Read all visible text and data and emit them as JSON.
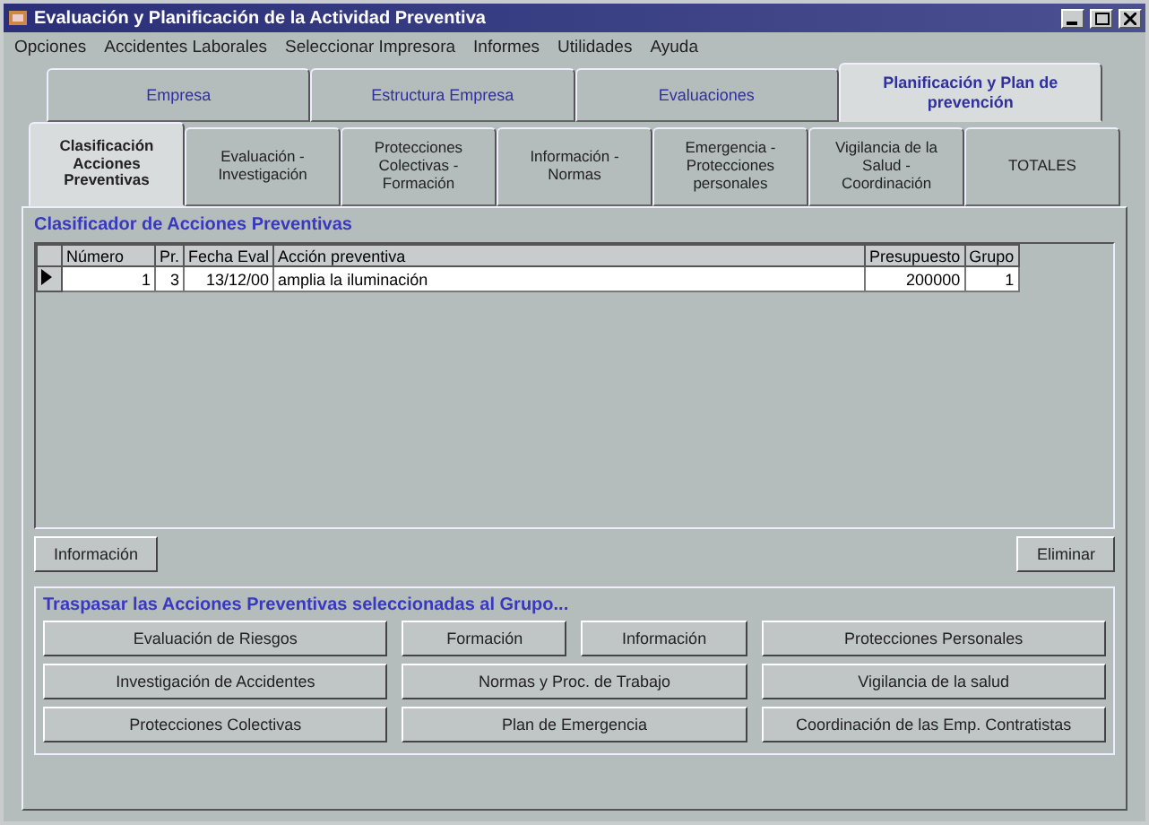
{
  "window": {
    "title": "Evaluación y Planificación de la Actividad Preventiva"
  },
  "menu": [
    "Opciones",
    "Accidentes Laborales",
    "Seleccionar Impresora",
    "Informes",
    "Utilidades",
    "Ayuda"
  ],
  "tabs": [
    {
      "label": "Empresa",
      "selected": false
    },
    {
      "label": "Estructura Empresa",
      "selected": false
    },
    {
      "label": "Evaluaciones",
      "selected": false
    },
    {
      "label": "Planificación y Plan de prevención",
      "selected": true
    }
  ],
  "subtabs": [
    {
      "label": "Clasificación Acciones Preventivas",
      "selected": true
    },
    {
      "label": "Evaluación - Investigación",
      "selected": false
    },
    {
      "label": "Protecciones Colectivas - Formación",
      "selected": false
    },
    {
      "label": "Información - Normas",
      "selected": false
    },
    {
      "label": "Emergencia - Protecciones personales",
      "selected": false
    },
    {
      "label": "Vigilancia de la Salud - Coordinación",
      "selected": false
    },
    {
      "label": "TOTALES",
      "selected": false
    }
  ],
  "panel": {
    "title": "Clasificador de Acciones Preventivas"
  },
  "table": {
    "columns": [
      "Número",
      "Pr.",
      "Fecha Eval",
      "Acción preventiva",
      "Presupuesto",
      "Grupo"
    ],
    "rows": [
      {
        "selected": true,
        "cells": [
          "1",
          "3",
          "13/12/00",
          "amplia la iluminación",
          "200000",
          "1"
        ]
      }
    ]
  },
  "buttons": [
    "Información",
    "Eliminar"
  ],
  "group": {
    "title": "Traspasar las Acciones Preventivas seleccionadas al Grupo...",
    "rows": [
      [
        "Evaluación de Riesgos",
        "Formación",
        "Información",
        "Protecciones Personales"
      ],
      [
        "Investigación de Accidentes",
        "Normas y Proc. de Trabajo",
        "Vigilancia de la salud"
      ],
      [
        "Protecciones Colectivas",
        "Plan de Emergencia",
        "Coordinación de las Emp. Contratistas"
      ]
    ]
  }
}
